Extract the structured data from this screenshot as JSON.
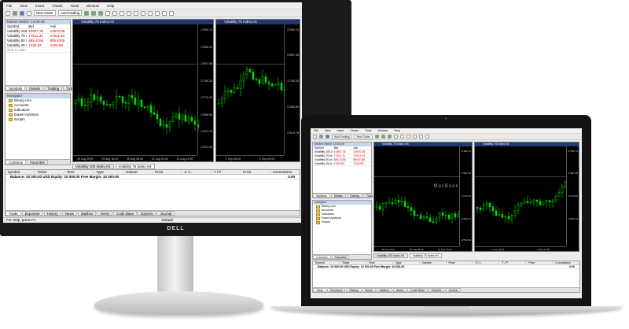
{
  "monitor_brand": "DELL",
  "laptop_brand": "MacBook",
  "menu": [
    "File",
    "View",
    "Insert",
    "Charts",
    "Tools",
    "Window",
    "Help"
  ],
  "toolbar": {
    "new_order": "New Order",
    "autotrading": "AutoTrading"
  },
  "market_watch": {
    "title": "Market Watch: 14:08:49",
    "columns": [
      "Symbol",
      "Bid",
      "Ask"
    ],
    "rows": [
      {
        "symbol": "Volatility 100 Index",
        "bid": "10507.35",
        "ask": "10570.35"
      },
      {
        "symbol": "Volatility 75 Index",
        "bid": "17611.31",
        "ask": "17611.94"
      },
      {
        "symbol": "Volatility 50 Index",
        "bid": "855.4156",
        "ask": "855.5156"
      },
      {
        "symbol": "Volatility 25 Index",
        "bid": "1320.83",
        "ask": "1320.93"
      }
    ],
    "add_row": "click to add...",
    "tabs": [
      "Symbols",
      "Details",
      "Trading",
      "Ticks"
    ]
  },
  "navigator": {
    "title": "Navigator",
    "items": [
      "Binary.com",
      "Accounts",
      "Indicators",
      "Expert Advisors",
      "Scripts"
    ],
    "tabs": [
      "Common",
      "Favorites"
    ]
  },
  "charts": {
    "left_title": "Volatility 75 Index,H4",
    "right_title": "Volatility 75 Index,H1",
    "time_labels": [
      "26 Aug 2016",
      "29 Aug 16:00",
      "30 Aug 08:00",
      "31 Aug 00:00",
      "31 Aug 16:00",
      "1 Sep 08:00",
      "2 Sep 00:00"
    ],
    "price_labels": [
      "17900.74",
      "17853.91",
      "17807.08",
      "17760.25",
      "17713.42",
      "17666.59",
      "17619.76",
      "17572.93"
    ],
    "tabs": [
      "Volatility 100 Index,H1",
      "Volatility 75 Index,H4"
    ]
  },
  "terminal": {
    "columns": [
      "Symbol",
      "Ticket",
      "Time",
      "Type",
      "Volume",
      "Price",
      "S / L",
      "T / P",
      "Price",
      "Commission"
    ],
    "balance_line": "Balance: 10 000.00 USD  Equity: 10 000.00  Free Margin: 10 000.00",
    "total": "0.00",
    "tabs": [
      "Trade",
      "Exposure",
      "History",
      "News",
      "Mailbox",
      "Alerts",
      "Code Base",
      "Experts",
      "Journal"
    ]
  },
  "status": {
    "help": "For Help, press F1",
    "profile": "Default"
  },
  "colors": {
    "candle": "#00e000",
    "chart_bg": "#000000",
    "title_bar": "#1f3a73",
    "bid_text": "#c00000"
  }
}
